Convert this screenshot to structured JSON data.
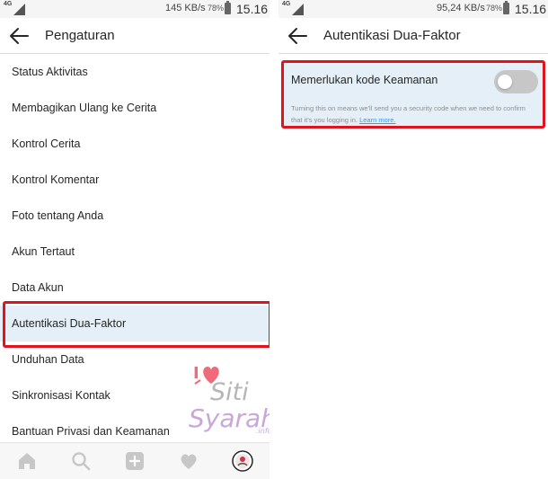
{
  "left_screen": {
    "status": {
      "network": "4G",
      "speed": "145 KB/s",
      "battery": "78%",
      "time": "15.16"
    },
    "header": {
      "title": "Pengaturan"
    },
    "menu_items": [
      {
        "label": "Status Aktivitas"
      },
      {
        "label": "Membagikan Ulang ke Cerita"
      },
      {
        "label": "Kontrol Cerita"
      },
      {
        "label": "Kontrol Komentar"
      },
      {
        "label": "Foto tentang Anda"
      },
      {
        "label": "Akun Tertaut"
      },
      {
        "label": "Data Akun"
      },
      {
        "label": "Autentikasi Dua-Faktor",
        "highlighted": true
      },
      {
        "label": "Unduhan Data"
      },
      {
        "label": "Sinkronisasi Kontak"
      },
      {
        "label": "Bantuan Privasi dan Keamanan"
      }
    ],
    "bottom_nav": [
      "home-icon",
      "search-icon",
      "add-post-icon",
      "heart-icon",
      "profile-avatar"
    ]
  },
  "right_screen": {
    "status": {
      "network": "4G",
      "speed": "95,24 KB/s",
      "battery": "78%",
      "time": "15.16"
    },
    "header": {
      "title": "Autentikasi Dua-Faktor"
    },
    "setting": {
      "label": "Memerlukan kode Keamanan",
      "toggle_state": "off",
      "description": "Turning this on means we'll send you a security code when we need to confirm that it's you logging in.",
      "link": "Learn more."
    }
  },
  "watermark": {
    "line1": "Siti",
    "line2": "Syarah",
    "suffix": ".info",
    "colors": {
      "heart": "#f06b7a",
      "text": "#c9a8d8",
      "accent": "#f5d36a"
    }
  },
  "colors": {
    "highlight_bg": "#e4eff8",
    "red_annotation": "#e0141e",
    "link": "#3897f0",
    "toggle_off": "#c7c7c7"
  }
}
